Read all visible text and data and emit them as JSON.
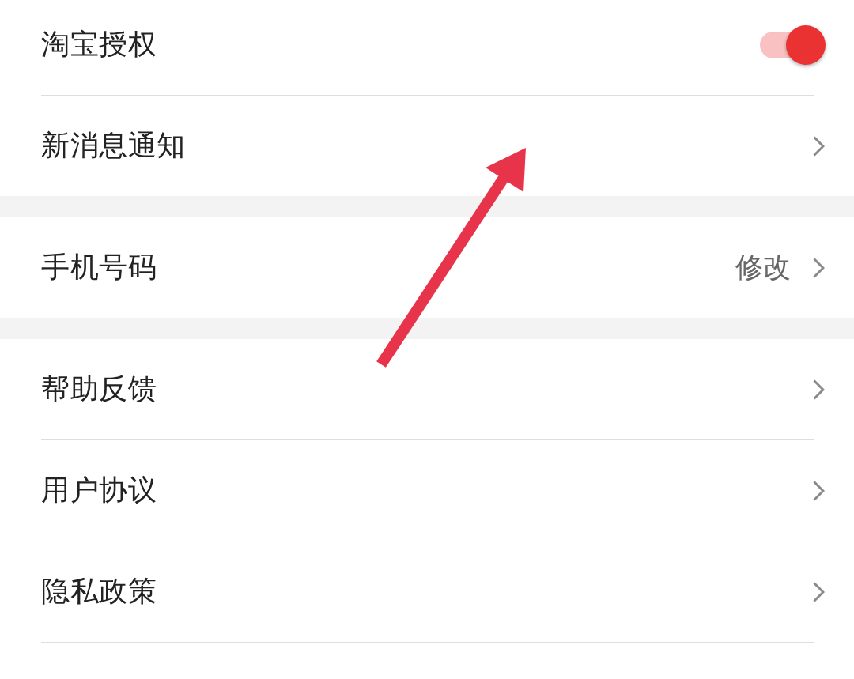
{
  "settings_groups": [
    {
      "items": [
        {
          "kind": "toggle",
          "label": "淘宝授权",
          "on": true
        },
        {
          "kind": "link",
          "label": "新消息通知"
        }
      ]
    },
    {
      "items": [
        {
          "kind": "link",
          "label": "手机号码",
          "value": "修改"
        }
      ]
    },
    {
      "items": [
        {
          "kind": "link",
          "label": "帮助反馈"
        },
        {
          "kind": "link",
          "label": "用户协议"
        },
        {
          "kind": "link",
          "label": "隐私政策"
        }
      ]
    }
  ]
}
